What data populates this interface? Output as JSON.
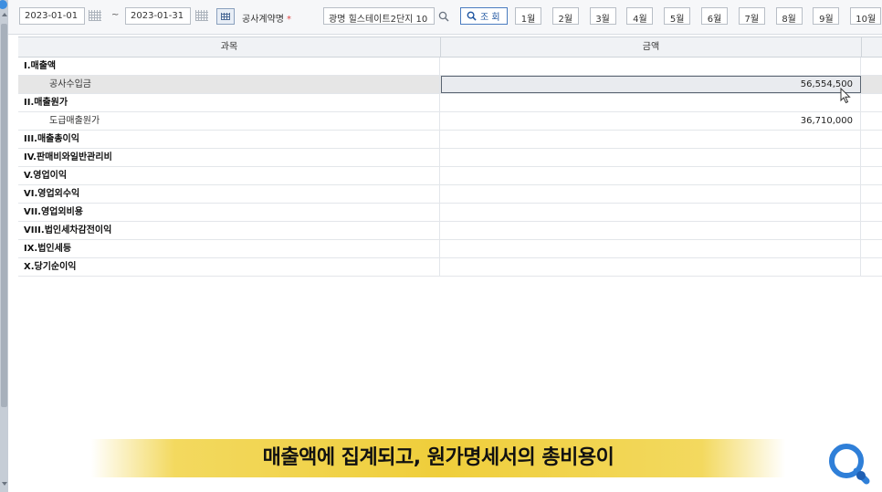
{
  "toolbar": {
    "date_from": "2023-01-01",
    "date_separator": "~",
    "date_to": "2023-01-31",
    "contract_label": "공사계약명",
    "contract_required_mark": "*",
    "contract_value": "광명 힐스테이트2단지 10",
    "query_button": "조 회",
    "months": [
      "1월",
      "2월",
      "3월",
      "4월",
      "5월",
      "6월",
      "7월",
      "8월",
      "9월",
      "10월"
    ]
  },
  "grid": {
    "columns": [
      "과목",
      "금액"
    ],
    "rows": [
      {
        "label": "I.매출액",
        "amount": "",
        "type": "head"
      },
      {
        "label": "공사수입금",
        "amount": "56,554,500",
        "type": "sub",
        "selected": true
      },
      {
        "label": "II.매출원가",
        "amount": "",
        "type": "head"
      },
      {
        "label": "도급매출원가",
        "amount": "36,710,000",
        "type": "sub"
      },
      {
        "label": "III.매출총이익",
        "amount": "",
        "type": "head"
      },
      {
        "label": "IV.판매비와일반관리비",
        "amount": "",
        "type": "head"
      },
      {
        "label": "V.영업이익",
        "amount": "",
        "type": "head"
      },
      {
        "label": "VI.영업외수익",
        "amount": "",
        "type": "head"
      },
      {
        "label": "VII.영업외비용",
        "amount": "",
        "type": "head"
      },
      {
        "label": "VIII.법인세차감전이익",
        "amount": "",
        "type": "head"
      },
      {
        "label": "IX.법인세등",
        "amount": "",
        "type": "head"
      },
      {
        "label": "X.당기순이익",
        "amount": "",
        "type": "head"
      }
    ]
  },
  "subtitle": "매출액에 집계되고, 원가명세서의 총비용이",
  "icons": {
    "calendar": "calendar-grid-icon",
    "search": "magnifier-icon",
    "cursor": "mouse-pointer-icon",
    "logo": "magnifier-logo"
  },
  "colors": {
    "subtitle_bg": "#efce3b",
    "required_mark": "#e04848",
    "query_button_text": "#1e55a0",
    "logo_blue": "#2f7fd8"
  }
}
